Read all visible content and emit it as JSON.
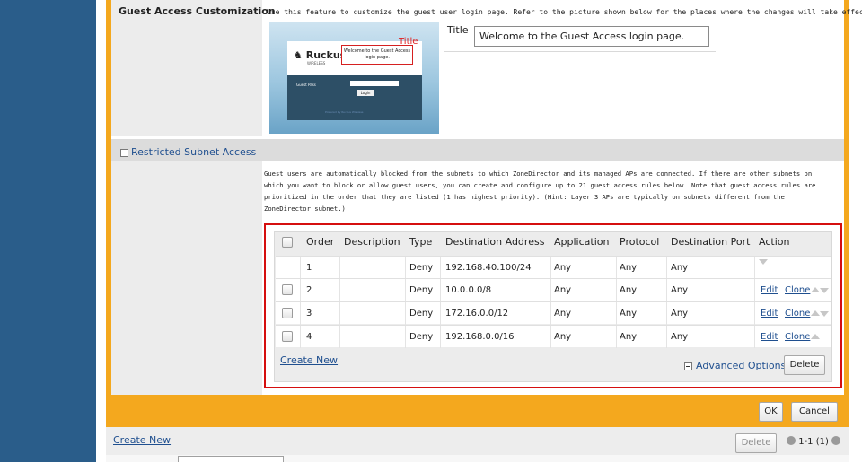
{
  "guest_access": {
    "label": "Guest Access Customization",
    "description": "Use this feature to customize the guest user login page. Refer to the picture shown below for the places where the changes will take effect.",
    "preview": {
      "logo_text": "Ruckus",
      "logo_sub": "WIRELESS",
      "welcome_box": "Welcome to the Guest Access login page.",
      "title_tag": "Title",
      "guest_pass_label": "Guest Pass",
      "login_button": "Login",
      "footer": "Powered by Ruckus Wireless"
    },
    "title_field": {
      "label": "Title",
      "value": "Welcome to the Guest Access login page."
    }
  },
  "restricted_subnet": {
    "section_title": "Restricted Subnet Access",
    "description_lines": [
      "Guest users are automatically blocked from the subnets to which ZoneDirector and its managed APs are connected. If there are other subnets on",
      "which you want to block or allow guest users, you can create and configure up to 21 guest access rules below. Note that guest access rules are",
      "prioritized in the order that they are listed (1 has highest priority). (Hint: Layer 3 APs are typically on subnets different from the",
      "ZoneDirector subnet.)"
    ],
    "table": {
      "headers": [
        "Order",
        "Description",
        "Type",
        "Destination Address",
        "Application",
        "Protocol",
        "Destination Port",
        "Action"
      ],
      "rows": [
        {
          "order": "1",
          "description": "",
          "type": "Deny",
          "destination": "192.168.40.100/24",
          "application": "Any",
          "protocol": "Any",
          "port": "Any",
          "edit": "",
          "clone": ""
        },
        {
          "order": "2",
          "description": "",
          "type": "Deny",
          "destination": "10.0.0.0/8",
          "application": "Any",
          "protocol": "Any",
          "port": "Any",
          "edit": "Edit",
          "clone": "Clone"
        },
        {
          "order": "3",
          "description": "",
          "type": "Deny",
          "destination": "172.16.0.0/12",
          "application": "Any",
          "protocol": "Any",
          "port": "Any",
          "edit": "Edit",
          "clone": "Clone"
        },
        {
          "order": "4",
          "description": "",
          "type": "Deny",
          "destination": "192.168.0.0/16",
          "application": "Any",
          "protocol": "Any",
          "port": "Any",
          "edit": "Edit",
          "clone": "Clone"
        }
      ]
    },
    "create_new": "Create New",
    "advanced_options": "Advanced Options",
    "delete_button": "Delete"
  },
  "form_actions": {
    "ok": "OK",
    "cancel": "Cancel"
  },
  "footer": {
    "create_new": "Create New",
    "delete_button": "Delete",
    "pager_text": "1-1 (1)"
  },
  "colors": {
    "accent_orange": "#f4a81e",
    "nav_blue": "#2a5d8a",
    "link_blue": "#1f4f8f",
    "highlight_red": "#d50f0f"
  }
}
